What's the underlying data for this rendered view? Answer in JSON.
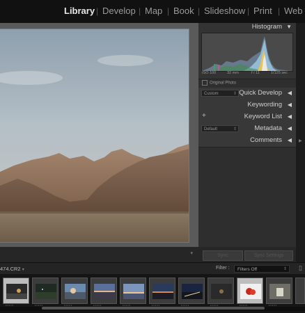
{
  "modules": [
    {
      "label": "Library",
      "active": true
    },
    {
      "label": "Develop",
      "active": false
    },
    {
      "label": "Map",
      "active": false
    },
    {
      "label": "Book",
      "active": false
    },
    {
      "label": "Slideshow",
      "active": false
    },
    {
      "label": "Print",
      "active": false
    },
    {
      "label": "Web",
      "active": false
    }
  ],
  "separator": "|",
  "histogram": {
    "title": "Histogram",
    "iso": "ISO 100",
    "focal": "32 mm",
    "aperture": "f / 11",
    "shutter": "1/125 sec",
    "original_photo_label": "Original Photo"
  },
  "panels": {
    "quick_develop": {
      "label": "Quick Develop",
      "preset": "Custom"
    },
    "keywording": {
      "label": "Keywording"
    },
    "keyword_list": {
      "label": "Keyword List",
      "add": "+"
    },
    "metadata": {
      "label": "Metadata",
      "preset": "Default"
    },
    "comments": {
      "label": "Comments"
    }
  },
  "buttons": {
    "sync": "Sync",
    "sync_settings": "Sync Settings"
  },
  "filmstrip": {
    "filename": "474.CR2",
    "filter_label": "Filter :",
    "filter_value": "Filters Off",
    "thumb_count": 11
  },
  "icons": {
    "collapse": "triangle-down-icon",
    "expand": "triangle-left-icon"
  },
  "colors": {
    "accent": "#e8e8e8",
    "panel": "#2e2e2e",
    "background": "#1a1a1a"
  }
}
